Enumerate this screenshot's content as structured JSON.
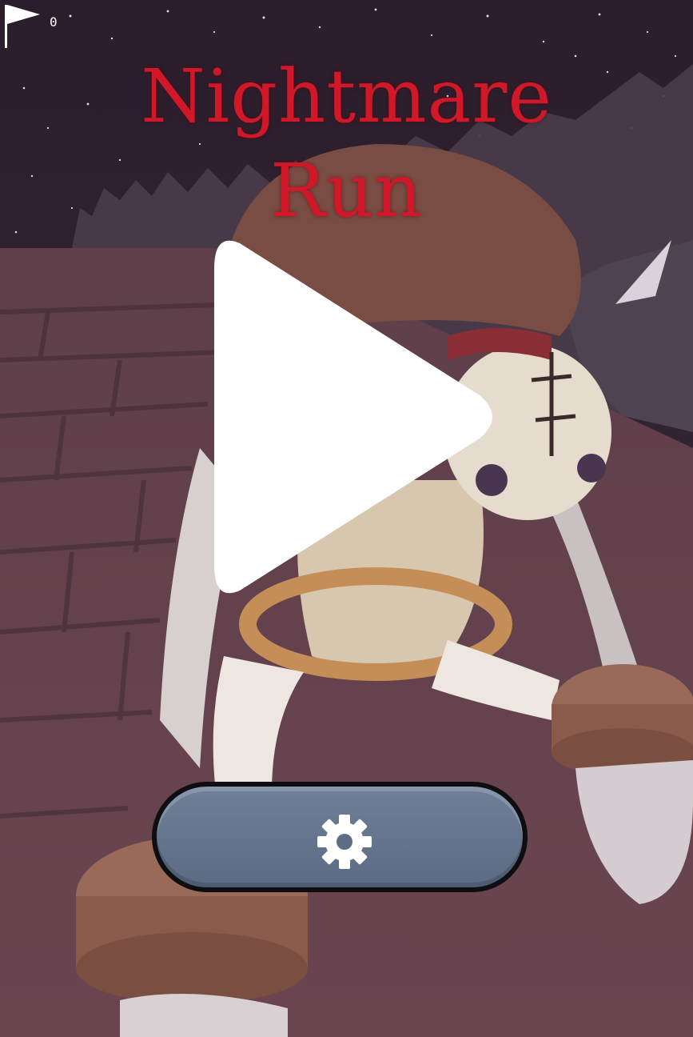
{
  "hud": {
    "flag_count": "0",
    "flag_icon": "flag-icon"
  },
  "title": {
    "line1": "Nightmare",
    "line2": "Run"
  },
  "play_button": {
    "icon": "play-icon"
  },
  "settings_button": {
    "icon": "gear-icon"
  },
  "colors": {
    "title_red": "#d01828",
    "sky": "#2e1f2e",
    "button": "#5e6e86"
  }
}
